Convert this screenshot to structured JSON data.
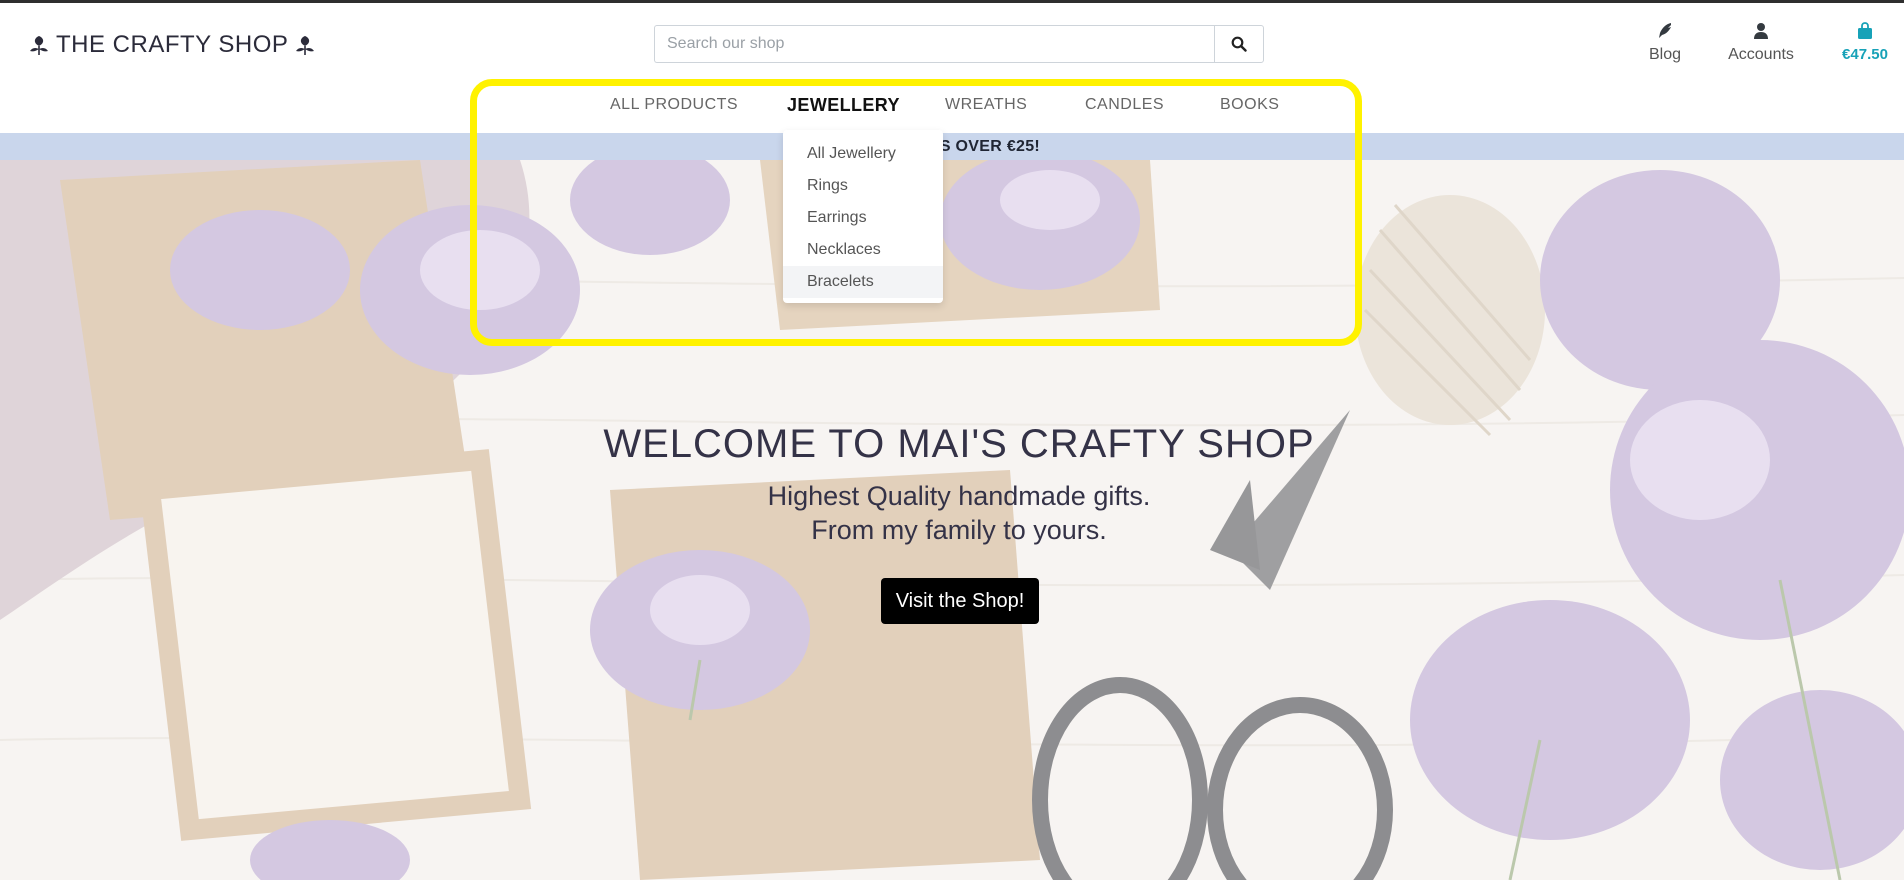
{
  "header": {
    "logo_text": "THE CRAFTY SHOP",
    "search": {
      "placeholder": "Search our shop",
      "value": ""
    },
    "links": {
      "blog": "Blog",
      "accounts": "Accounts",
      "bag_total": "€47.50"
    }
  },
  "nav": {
    "items": [
      "ALL PRODUCTS",
      "JEWELLERY",
      "WREATHS",
      "CANDLES",
      "BOOKS"
    ],
    "active": "JEWELLERY",
    "dropdown": {
      "items": [
        "All Jewellery",
        "Rings",
        "Earrings",
        "Necklaces",
        "Bracelets"
      ],
      "hovered": "Bracelets"
    }
  },
  "banner": {
    "text": "N ORDERS OVER €25!"
  },
  "hero": {
    "title": "WELCOME TO MAI'S CRAFTY SHOP",
    "subtitle_line1": "Highest Quality handmade gifts.",
    "subtitle_line2": "From my family to yours.",
    "cta": "Visit the Shop!"
  },
  "colors": {
    "accent": "#17a2b8",
    "banner_bg": "#c9d6ec",
    "highlight": "#fff200",
    "text_dark": "#343247",
    "button_bg": "#000000"
  },
  "icons": [
    "leaf-icon",
    "search-icon",
    "pen-icon",
    "user-icon",
    "shopping-bag-icon"
  ]
}
